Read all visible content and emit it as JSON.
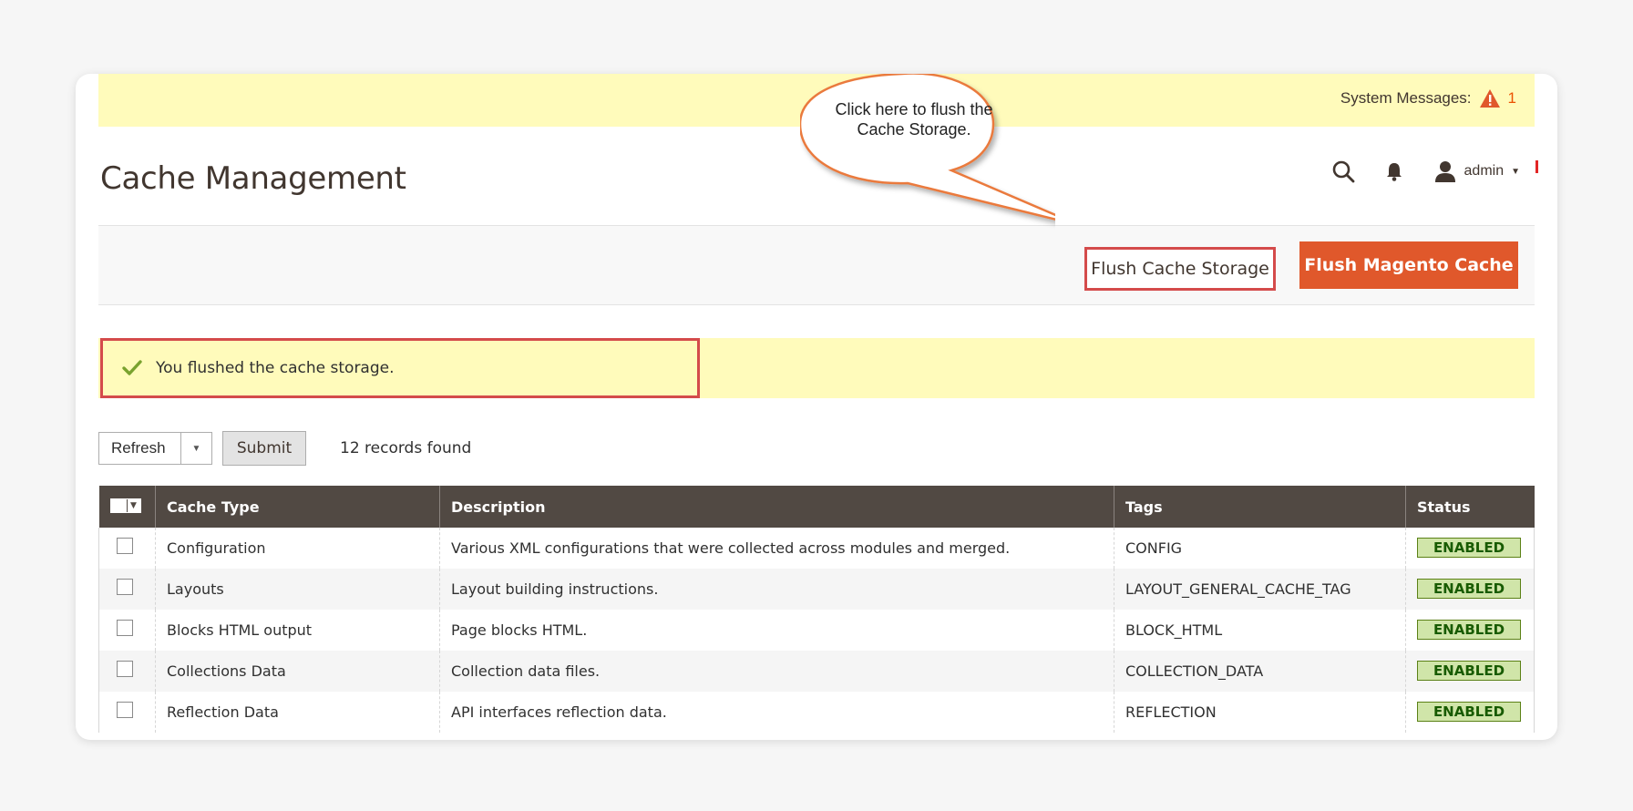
{
  "system_messages": {
    "label": "System Messages:",
    "count": "1",
    "icon": "warning-icon"
  },
  "page": {
    "title": "Cache Management"
  },
  "header": {
    "admin_label": "admin",
    "search_icon": "search-icon",
    "bell_icon": "bell-icon",
    "user_icon": "user-icon"
  },
  "actions": {
    "flush_storage": "Flush Cache Storage",
    "flush_magento": "Flush Magento Cache"
  },
  "callout": {
    "text": "Click here to flush the Cache Storage."
  },
  "success": {
    "message": "You flushed the cache storage."
  },
  "toolbar": {
    "action_select": "Refresh",
    "submit": "Submit",
    "records": "12 records found"
  },
  "grid": {
    "headers": [
      "Cache Type",
      "Description",
      "Tags",
      "Status"
    ],
    "rows": [
      {
        "type": "Configuration",
        "description": "Various XML configurations that were collected across modules and merged.",
        "tags": "CONFIG",
        "status": "ENABLED"
      },
      {
        "type": "Layouts",
        "description": "Layout building instructions.",
        "tags": "LAYOUT_GENERAL_CACHE_TAG",
        "status": "ENABLED"
      },
      {
        "type": "Blocks HTML output",
        "description": "Page blocks HTML.",
        "tags": "BLOCK_HTML",
        "status": "ENABLED"
      },
      {
        "type": "Collections Data",
        "description": "Collection data files.",
        "tags": "COLLECTION_DATA",
        "status": "ENABLED"
      },
      {
        "type": "Reflection Data",
        "description": "API interfaces reflection data.",
        "tags": "REFLECTION",
        "status": "ENABLED"
      }
    ]
  },
  "colors": {
    "accent": "#e0582b",
    "highlight_border": "#d44b4b",
    "notice_bg": "#fffbbb",
    "header_bg": "#514943",
    "enabled_bg": "#d0e5a9"
  }
}
